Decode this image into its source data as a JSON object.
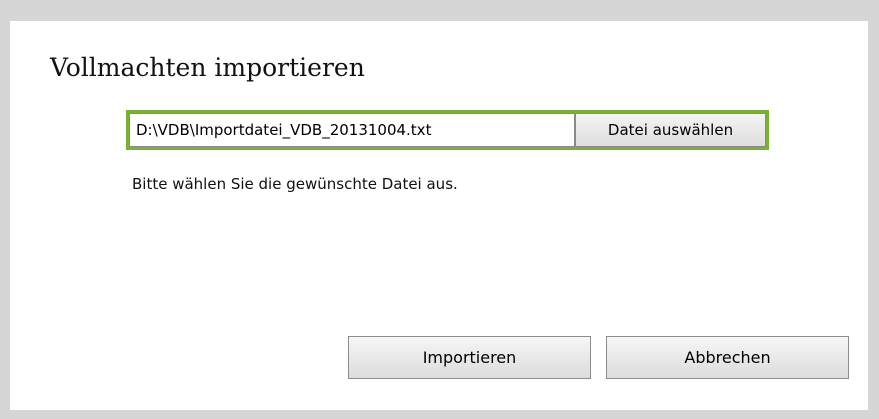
{
  "dialog": {
    "title": "Vollmachten importieren",
    "file_input_value": "D:\\VDB\\Importdatei_VDB_20131004.txt",
    "browse_label": "Datei auswählen",
    "hint": "Bitte wählen Sie die gewünschte Datei aus.",
    "import_label": "Importieren",
    "cancel_label": "Abbrechen"
  },
  "colors": {
    "accent_border": "#7cae3a",
    "backdrop": "#d6d6d6"
  }
}
